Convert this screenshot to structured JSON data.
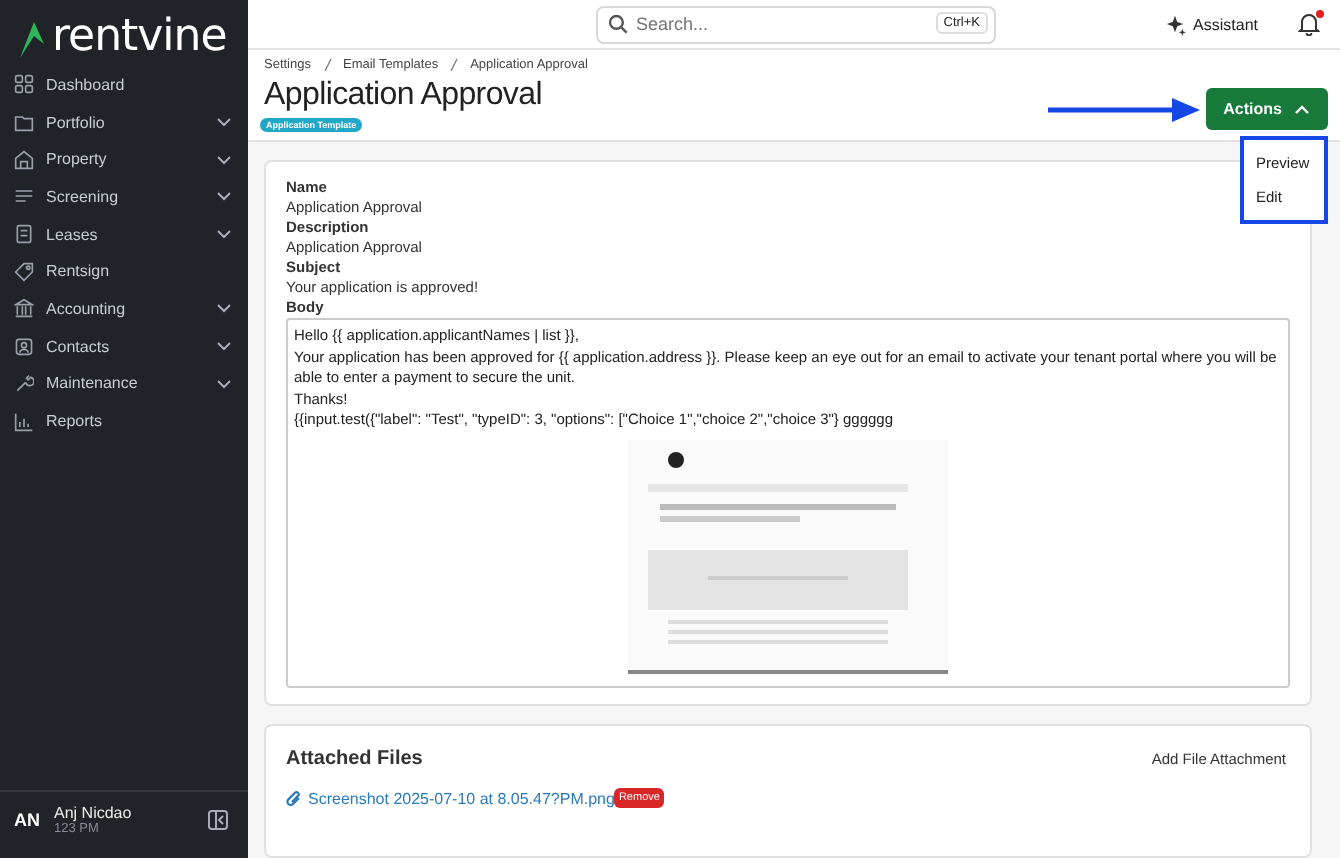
{
  "sidebar": {
    "logo": "rentvine",
    "items": [
      {
        "label": "Dashboard",
        "expandable": false
      },
      {
        "label": "Portfolio",
        "expandable": true
      },
      {
        "label": "Property",
        "expandable": true
      },
      {
        "label": "Screening",
        "expandable": true
      },
      {
        "label": "Leases",
        "expandable": true
      },
      {
        "label": "Rentsign",
        "expandable": false
      },
      {
        "label": "Accounting",
        "expandable": true
      },
      {
        "label": "Contacts",
        "expandable": true
      },
      {
        "label": "Maintenance",
        "expandable": true
      },
      {
        "label": "Reports",
        "expandable": false
      }
    ],
    "user": {
      "initials": "AN",
      "name": "Anj Nicdao",
      "time": "123 PM"
    }
  },
  "topbar": {
    "search": {
      "placeholder": "Search...",
      "shortcut": "Ctrl+K"
    },
    "assistant": "Assistant",
    "unread": true
  },
  "breadcrumbs": [
    "Settings",
    "Email Templates",
    "Application Approval"
  ],
  "title": "Application Approval",
  "badge": "Application Template",
  "actions": {
    "label": "Actions",
    "expanded": true,
    "menu": [
      "Preview",
      "Edit"
    ]
  },
  "fields": [
    {
      "label": "Name",
      "value": "Application Approval"
    },
    {
      "label": "Description",
      "value": "Application Approval"
    },
    {
      "label": "Subject",
      "value": "Your application is approved!"
    }
  ],
  "body": {
    "label": "Body",
    "lines": [
      "Hello {{ application.applicantNames | list }},",
      "Your application has been approved for {{ application.address }}. Please keep an eye out for an email to activate your tenant portal where you will be able to enter a payment to secure the unit.",
      "Thanks!",
      "{{input.test({\"label\": \"Test\", \"typeID\": 3, \"options\": [\"Choice 1\",\"choice 2\",\"choice 3\"} gggggg"
    ]
  },
  "attachments": {
    "title": "Attached Files",
    "add": "Add File Attachment",
    "files": [
      {
        "name": "Screenshot 2025-07-10 at 8.05.47?PM.png",
        "remove": "Remove"
      }
    ]
  }
}
